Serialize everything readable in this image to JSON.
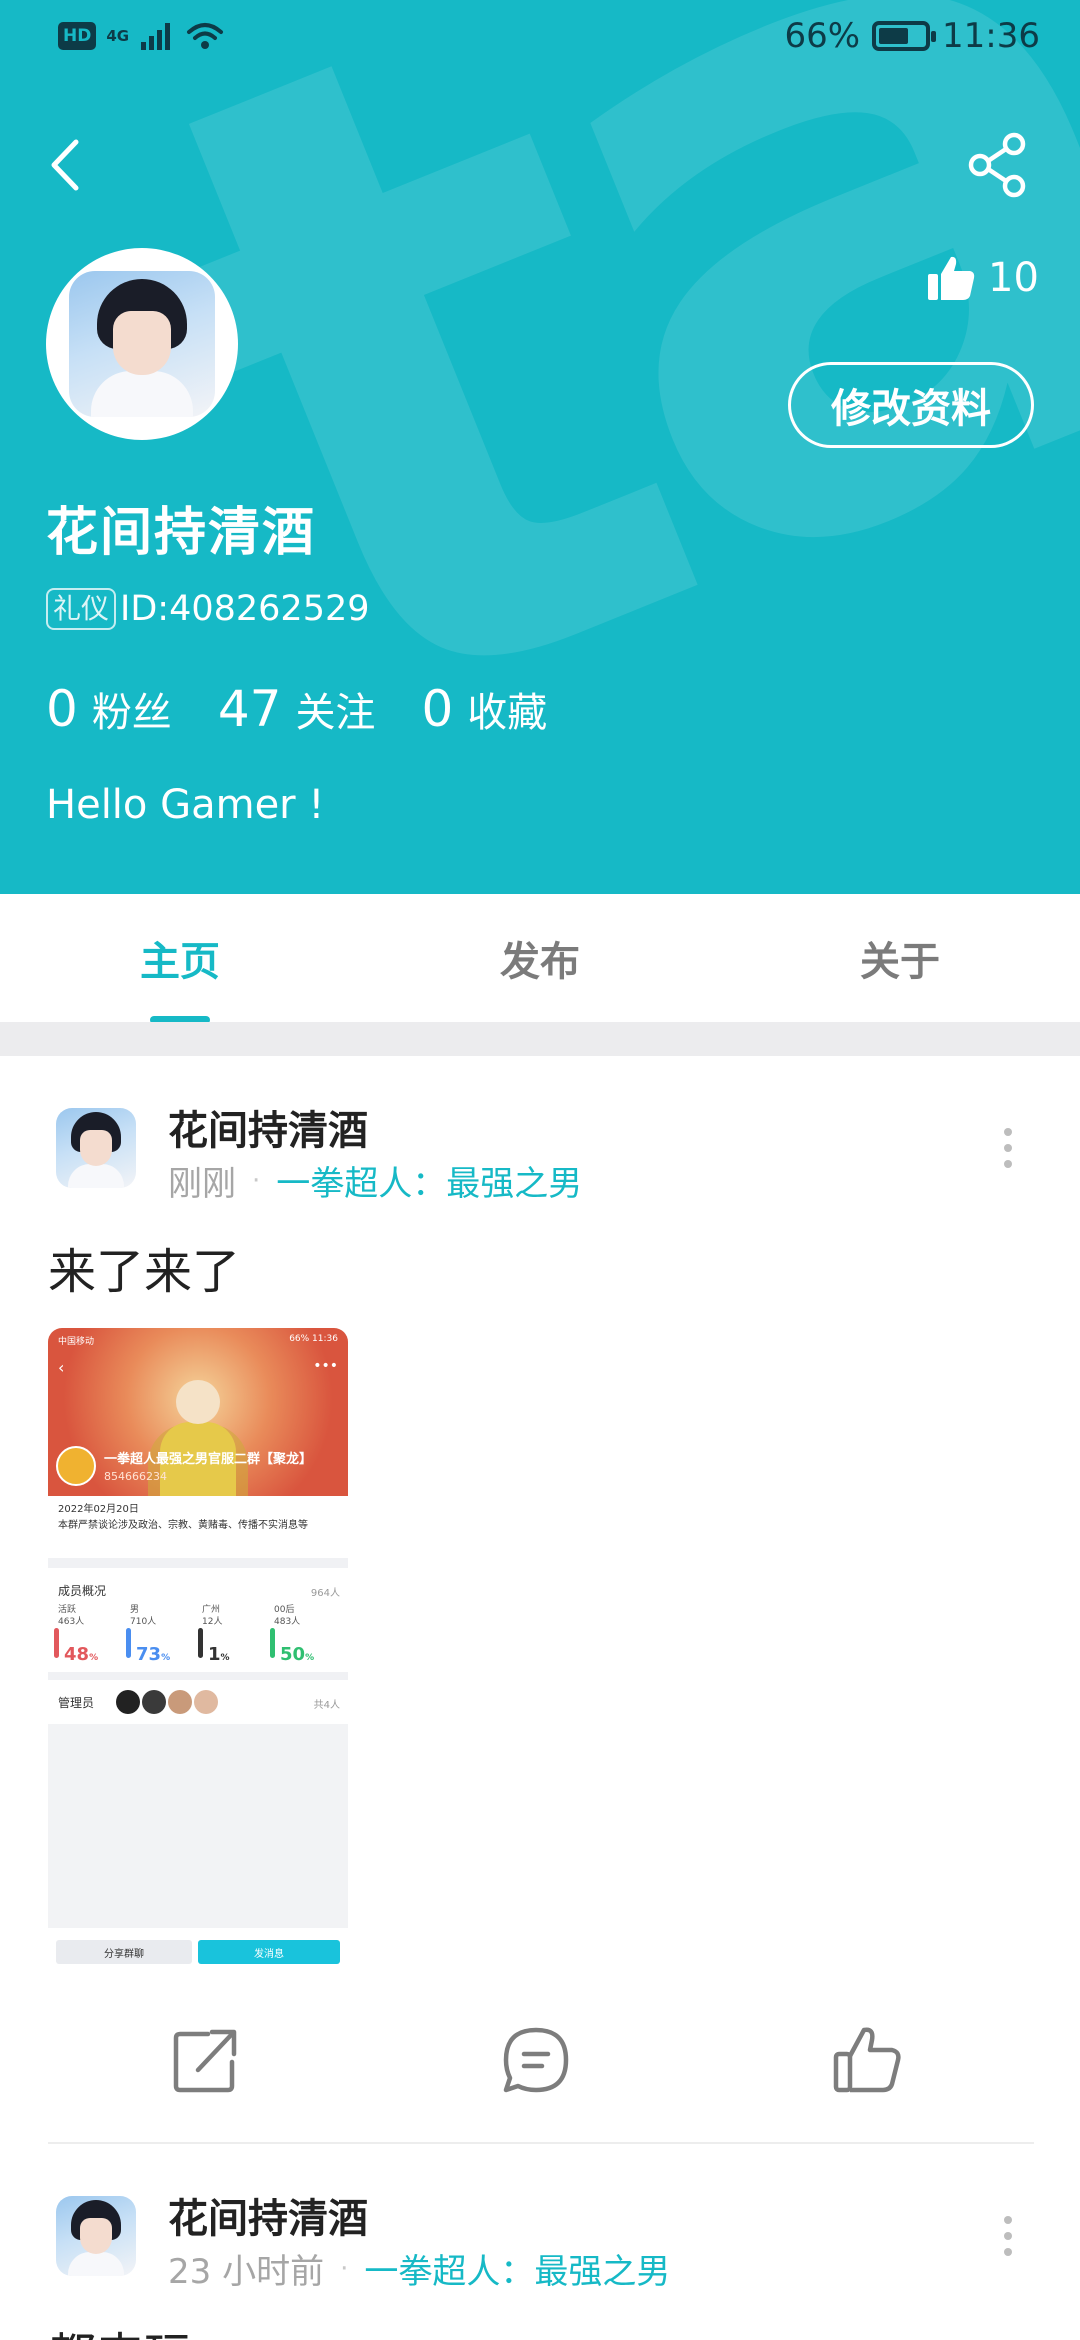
{
  "status_bar": {
    "hd": "HD",
    "network": "4G",
    "battery_percent": "66%",
    "battery_level": 0.66,
    "time": "11:36"
  },
  "profile": {
    "watermark": "tapta",
    "likes": "10",
    "edit_button": "修改资料",
    "username": "花间持清酒",
    "tag": "礼仪",
    "id_text": "ID:408262529",
    "stats": [
      {
        "num": "0",
        "label": "粉丝"
      },
      {
        "num": "47",
        "label": "关注"
      },
      {
        "num": "0",
        "label": "收藏"
      }
    ],
    "bio": "Hello Gamer !"
  },
  "tabs": [
    {
      "label": "主页",
      "active": true
    },
    {
      "label": "发布",
      "active": false
    },
    {
      "label": "关于",
      "active": false
    }
  ],
  "posts": [
    {
      "author": "花间持清酒",
      "time": "刚刚",
      "group": "一拳超人：最强之男",
      "text": "来了来了",
      "screenshot": {
        "status_left": "中国移动",
        "status_right": "66% 11:36",
        "group_title": "一拳超人最强之男官服二群【聚龙】",
        "group_id": "854666234",
        "date_line": "2022年02月20日",
        "rule_line": "本群严禁谈论涉及政治、宗教、黄赌毒、传播不实消息等",
        "members_section": "成员概况",
        "members_total": "964人",
        "member_stats": [
          {
            "label": "活跃",
            "count": "463人",
            "pct": "48",
            "color": "#e2585c"
          },
          {
            "label": "男",
            "count": "710人",
            "pct": "73",
            "color": "#4a8ef0"
          },
          {
            "label": "广州",
            "count": "12人",
            "pct": "1",
            "color": "#333333"
          },
          {
            "label": "00后",
            "count": "483人",
            "pct": "50",
            "color": "#2fbf71"
          }
        ],
        "admin_section": "管理员",
        "admin_total": "共4人",
        "button_share": "分享群聊",
        "button_message": "发消息"
      }
    },
    {
      "author": "花间持清酒",
      "time": "23 小时前",
      "group": "一拳超人：最强之男",
      "text": "都来玩"
    }
  ],
  "icons": {
    "back": "back-arrow-icon",
    "share": "share-icon",
    "like": "thumbs-up-icon",
    "forward": "forward-icon",
    "comment": "comment-icon",
    "more": "more-vertical-icon"
  },
  "colors": {
    "accent": "#16b9c6",
    "header_bg": "#16b9c6",
    "text_dark": "#222222",
    "text_muted": "#a6a6a6"
  }
}
